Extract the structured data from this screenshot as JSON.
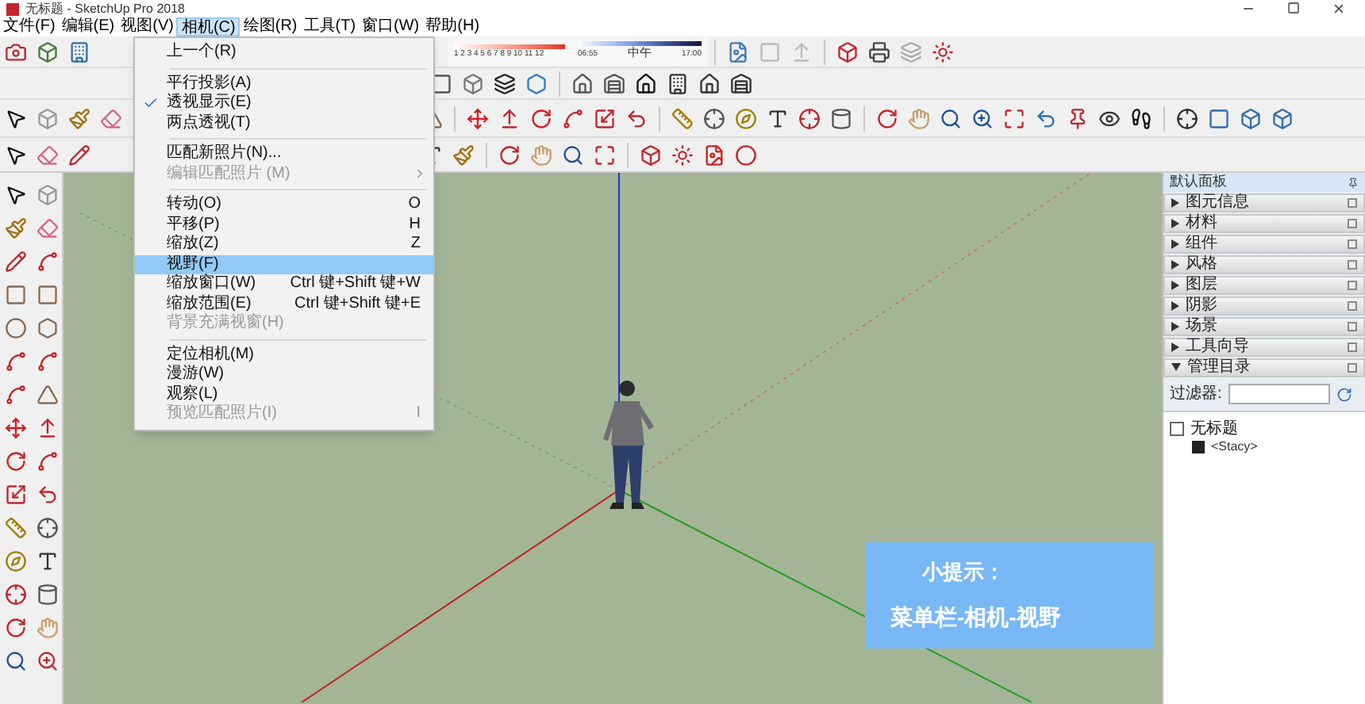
{
  "window": {
    "title": "无标题 - SketchUp Pro 2018"
  },
  "menu_bar": [
    {
      "label": "文件(F)",
      "selected": false
    },
    {
      "label": "编辑(E)",
      "selected": false
    },
    {
      "label": "视图(V)",
      "selected": false
    },
    {
      "label": "相机(C)",
      "selected": true
    },
    {
      "label": "绘图(R)",
      "selected": false
    },
    {
      "label": "工具(T)",
      "selected": false
    },
    {
      "label": "窗口(W)",
      "selected": false
    },
    {
      "label": "帮助(H)",
      "selected": false
    }
  ],
  "shadow_toolbar": {
    "months": "1 2 3 4 5 6 7 8 9 10 11 12",
    "time_start": "06:55",
    "time_mid": "中午",
    "time_end": "17:00"
  },
  "camera_menu": [
    {
      "kind": "item",
      "label": "上一个(R)",
      "checked": false,
      "disabled": false,
      "selected": false,
      "submenu": false
    },
    {
      "kind": "separator"
    },
    {
      "kind": "item",
      "label": "平行投影(A)",
      "checked": false,
      "disabled": false,
      "selected": false,
      "submenu": false
    },
    {
      "kind": "item",
      "label": "透视显示(E)",
      "checked": true,
      "disabled": false,
      "selected": false,
      "submenu": false
    },
    {
      "kind": "item",
      "label": "两点透视(T)",
      "checked": false,
      "disabled": false,
      "selected": false,
      "submenu": false
    },
    {
      "kind": "separator"
    },
    {
      "kind": "item",
      "label": "匹配新照片(N)...",
      "checked": false,
      "disabled": false,
      "selected": false,
      "submenu": false
    },
    {
      "kind": "item",
      "label": "编辑匹配照片 (M)",
      "checked": false,
      "disabled": true,
      "selected": false,
      "submenu": true
    },
    {
      "kind": "separator"
    },
    {
      "kind": "item",
      "label": "转动(O)",
      "shortcut": "O",
      "checked": false,
      "disabled": false,
      "selected": false,
      "submenu": false
    },
    {
      "kind": "item",
      "label": "平移(P)",
      "shortcut": "H",
      "checked": false,
      "disabled": false,
      "selected": false,
      "submenu": false
    },
    {
      "kind": "item",
      "label": "缩放(Z)",
      "shortcut": "Z",
      "checked": false,
      "disabled": false,
      "selected": false,
      "submenu": false
    },
    {
      "kind": "item",
      "label": "视野(F)",
      "checked": false,
      "disabled": false,
      "selected": true,
      "submenu": false
    },
    {
      "kind": "item",
      "label": "缩放窗口(W)",
      "shortcut": "Ctrl 键+Shift 键+W",
      "checked": false,
      "disabled": false,
      "selected": false,
      "submenu": false
    },
    {
      "kind": "item",
      "label": "缩放范围(E)",
      "shortcut": "Ctrl 键+Shift 键+E",
      "checked": false,
      "disabled": false,
      "selected": false,
      "submenu": false
    },
    {
      "kind": "item",
      "label": "背景充满视窗(H)",
      "checked": false,
      "disabled": true,
      "selected": false,
      "submenu": false
    },
    {
      "kind": "separator"
    },
    {
      "kind": "item",
      "label": "定位相机(M)",
      "checked": false,
      "disabled": false,
      "selected": false,
      "submenu": false
    },
    {
      "kind": "item",
      "label": "漫游(W)",
      "checked": false,
      "disabled": false,
      "selected": false,
      "submenu": false
    },
    {
      "kind": "item",
      "label": "观察(L)",
      "checked": false,
      "disabled": false,
      "selected": false,
      "submenu": false
    },
    {
      "kind": "item",
      "label": "预览匹配照片(I)",
      "shortcut": "I",
      "checked": false,
      "disabled": true,
      "selected": false,
      "submenu": false
    }
  ],
  "tray": {
    "title": "默认面板",
    "sections": [
      {
        "label": "图元信息",
        "expanded": false
      },
      {
        "label": "材料",
        "expanded": false
      },
      {
        "label": "组件",
        "expanded": false
      },
      {
        "label": "风格",
        "expanded": false
      },
      {
        "label": "图层",
        "expanded": false
      },
      {
        "label": "阴影",
        "expanded": false
      },
      {
        "label": "场景",
        "expanded": false
      },
      {
        "label": "工具向导",
        "expanded": false
      },
      {
        "label": "管理目录",
        "expanded": true
      }
    ],
    "filter_label": "过滤器:",
    "outliner": [
      {
        "label": "无标题",
        "children": [
          {
            "label": "<Stacy>"
          }
        ]
      }
    ]
  },
  "tip": {
    "title": "小提示：",
    "text": "菜单栏-相机-视野"
  }
}
